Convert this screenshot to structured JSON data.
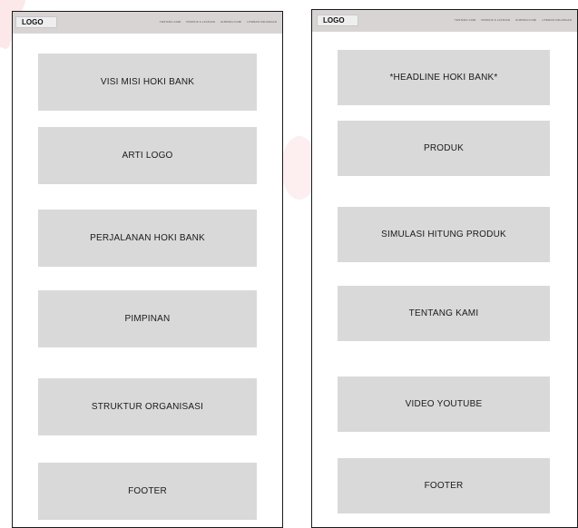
{
  "left_page": {
    "logo": "LOGO",
    "nav": [
      "TENTANG KAMI",
      "PRODUK & LAYANAN",
      "HUBUNGI KAMI",
      "LITERASI KEUANGAN"
    ],
    "sections": [
      "VISI MISI HOKI BANK",
      "ARTI LOGO",
      "PERJALANAN HOKI BANK",
      "PIMPINAN",
      "STRUKTUR  ORGANISASI",
      "FOOTER"
    ]
  },
  "right_page": {
    "logo": "LOGO",
    "nav": [
      "TENTANG KAMI",
      "PRODUK & LAYANAN",
      "HUBUNGI KAMI",
      "LITERASI KEUANGAN"
    ],
    "sections": [
      "*HEADLINE HOKI BANK*",
      "PRODUK",
      "SIMULASI HITUNG PRODUK",
      "TENTANG KAMI",
      "VIDEO YOUTUBE",
      "FOOTER"
    ]
  }
}
